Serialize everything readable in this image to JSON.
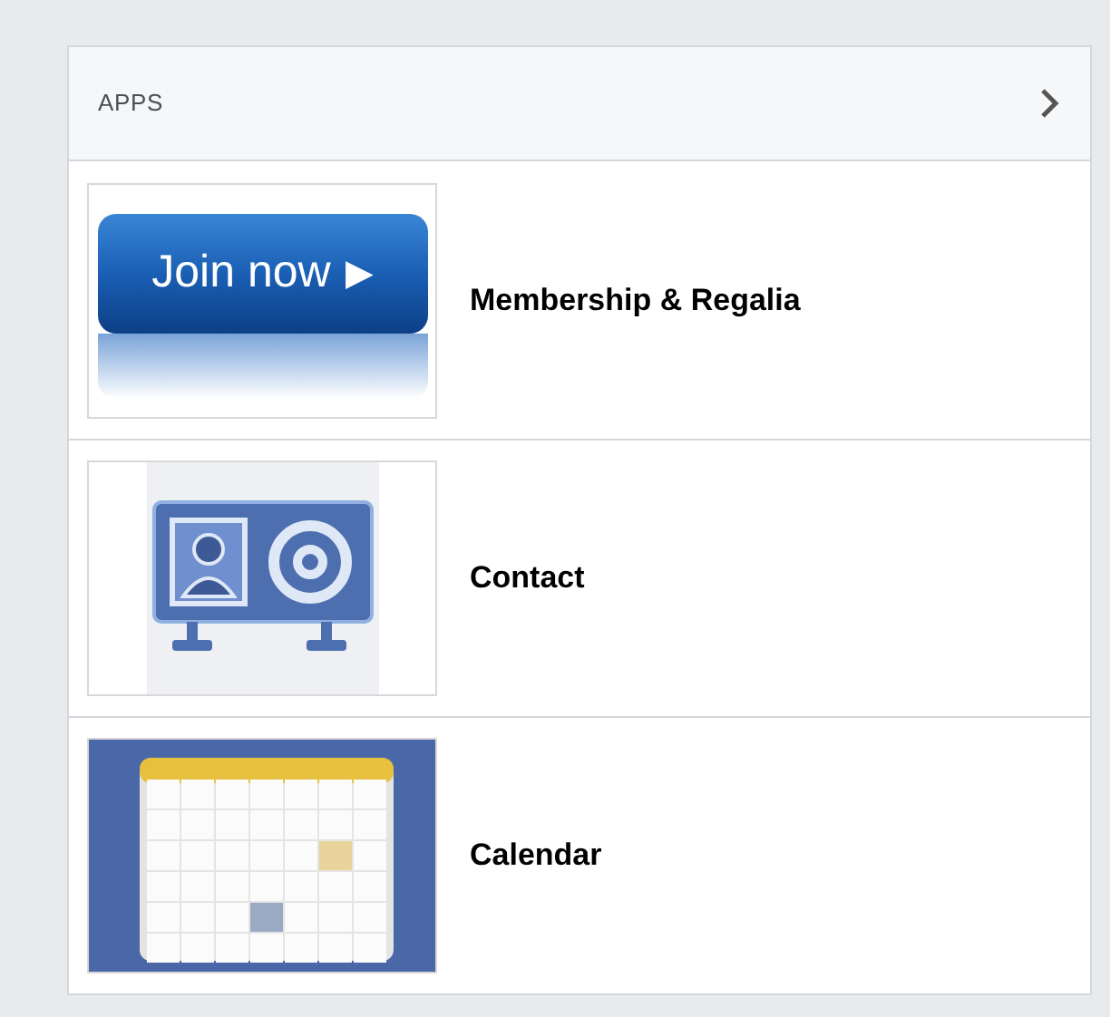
{
  "panel": {
    "title": "APPS"
  },
  "items": [
    {
      "kind": "join",
      "label": "Membership & Regalia",
      "thumbnail_text": "Join now",
      "thumbnail_arrow": "▶"
    },
    {
      "kind": "contact",
      "label": "Contact"
    },
    {
      "kind": "calendar",
      "label": "Calendar"
    }
  ]
}
